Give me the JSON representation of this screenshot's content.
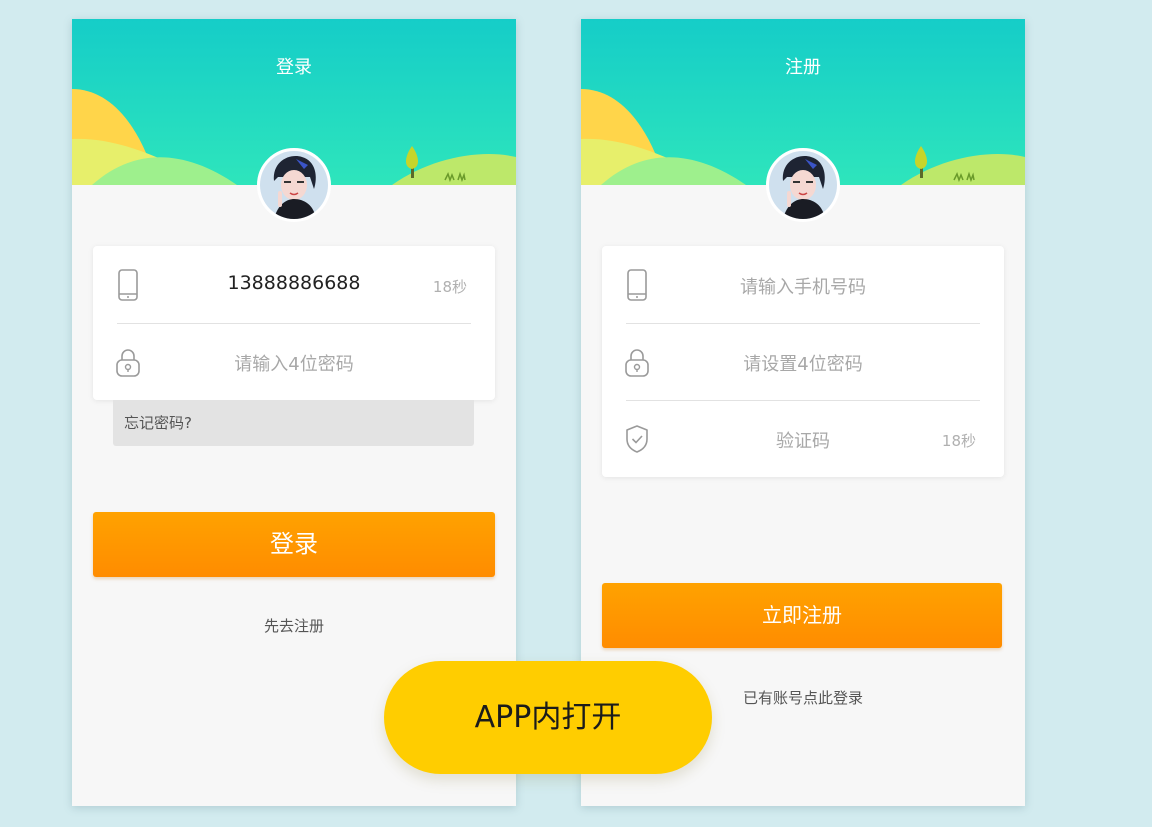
{
  "login": {
    "title": "登录",
    "phone_value": "13888886688",
    "timer": "18秒",
    "password_placeholder": "请输入4位密码",
    "forgot_label": "忘记密码?",
    "submit_label": "登录",
    "register_link": "先去注册"
  },
  "register": {
    "title": "注册",
    "phone_placeholder": "请输入手机号码",
    "password_placeholder": "请设置4位密码",
    "code_placeholder": "验证码",
    "timer": "18秒",
    "submit_label": "立即注册",
    "login_link": "已有账号点此登录"
  },
  "open_app_label": "APP内打开",
  "colors": {
    "header_top": "#15cdc8",
    "header_bottom": "#2ee5bc",
    "accent_orange": "#ff9400",
    "open_app_yellow": "#ffcd00",
    "background": "#d2ebef"
  },
  "icons": [
    "phone-icon",
    "lock-icon",
    "shield-check-icon",
    "tree-icon",
    "avatar-image"
  ]
}
